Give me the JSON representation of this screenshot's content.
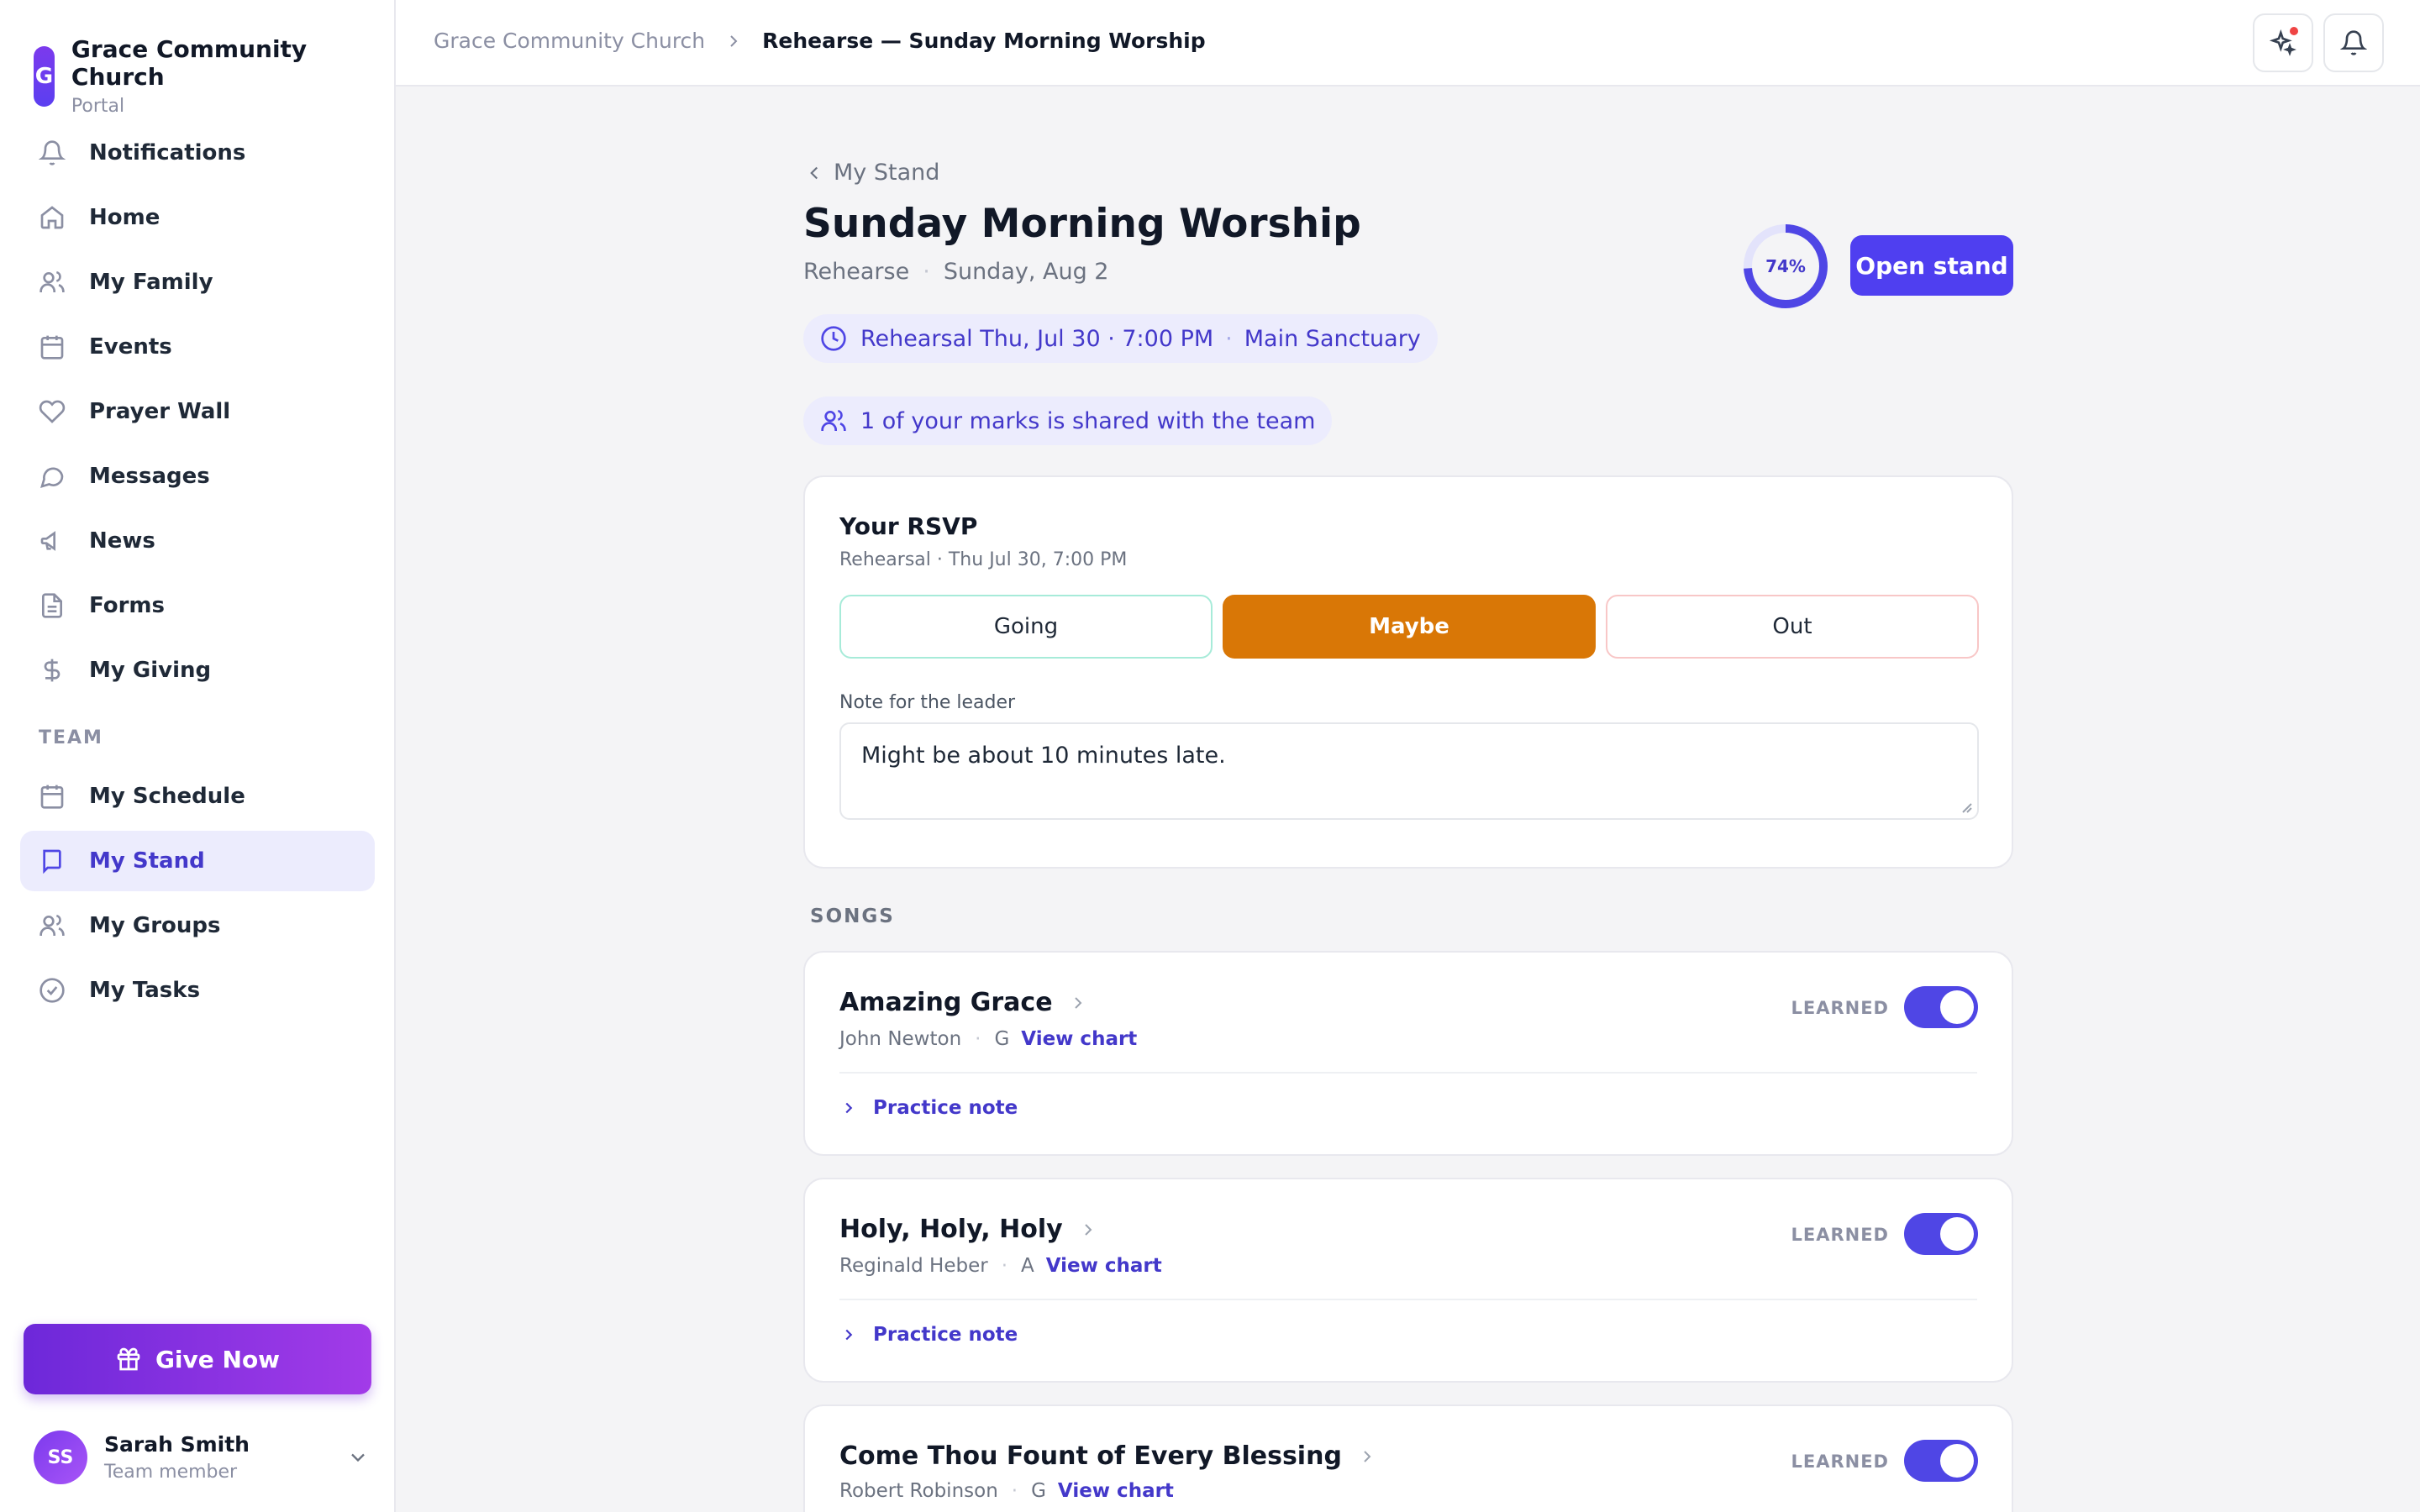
{
  "brand": {
    "logo_letter": "G",
    "name": "Grace Community Church",
    "subtitle": "Portal"
  },
  "nav": {
    "items": [
      {
        "label": "Notifications",
        "icon": "bell-icon"
      },
      {
        "label": "Home",
        "icon": "home-icon"
      },
      {
        "label": "My Family",
        "icon": "users-icon"
      },
      {
        "label": "Events",
        "icon": "calendar-icon"
      },
      {
        "label": "Prayer Wall",
        "icon": "heart-icon"
      },
      {
        "label": "Messages",
        "icon": "message-icon"
      },
      {
        "label": "News",
        "icon": "megaphone-icon"
      },
      {
        "label": "Forms",
        "icon": "document-icon"
      },
      {
        "label": "My Giving",
        "icon": "dollar-icon"
      }
    ],
    "team_section": "TEAM",
    "team_items": [
      {
        "label": "My Schedule",
        "icon": "calendar-icon"
      },
      {
        "label": "My Stand",
        "icon": "book-icon",
        "active": true
      },
      {
        "label": "My Groups",
        "icon": "users-icon"
      },
      {
        "label": "My Tasks",
        "icon": "check-circle-icon"
      }
    ]
  },
  "give_button": "Give Now",
  "user": {
    "initials": "SS",
    "name": "Sarah Smith",
    "role": "Team member"
  },
  "breadcrumb": {
    "root": "Grace Community Church",
    "current": "Rehearse — Sunday Morning Worship"
  },
  "page": {
    "back_label": "My Stand",
    "title": "Sunday Morning Worship",
    "mode": "Rehearse",
    "date": "Sunday, Aug 2",
    "rehearsal_time": "Rehearsal Thu, Jul 30 · 7:00 PM",
    "location": "Main Sanctuary",
    "shared_notice": "1 of your marks is shared with the team",
    "progress_label": "74%",
    "progress_value": 0.74,
    "open_stand_label": "Open stand"
  },
  "rsvp": {
    "title": "Your RSVP",
    "subtitle": "Rehearsal · Thu Jul 30, 7:00 PM",
    "options": {
      "going": "Going",
      "maybe": "Maybe",
      "out": "Out"
    },
    "selected": "Maybe",
    "note_label": "Note for the leader",
    "note_value": "Might be about 10 minutes late."
  },
  "songs_title": "SONGS",
  "songs": [
    {
      "title": "Amazing Grace",
      "author": "John Newton",
      "key": "G",
      "chart_label": "View chart",
      "learned_label": "LEARNED",
      "learned": true,
      "practice_label": "Practice note"
    },
    {
      "title": "Holy, Holy, Holy",
      "author": "Reginald Heber",
      "key": "A",
      "chart_label": "View chart",
      "learned_label": "LEARNED",
      "learned": true,
      "practice_label": "Practice note"
    },
    {
      "title": "Come Thou Fount of Every Blessing",
      "author": "Robert Robinson",
      "key": "G",
      "chart_label": "View chart",
      "learned_label": "LEARNED",
      "learned": true,
      "practice_label": "Practice note"
    }
  ],
  "colors": {
    "accent": "#4f46e5",
    "maybe": "#d97706",
    "give_start": "#6d28d9",
    "give_end": "#a23be8"
  }
}
